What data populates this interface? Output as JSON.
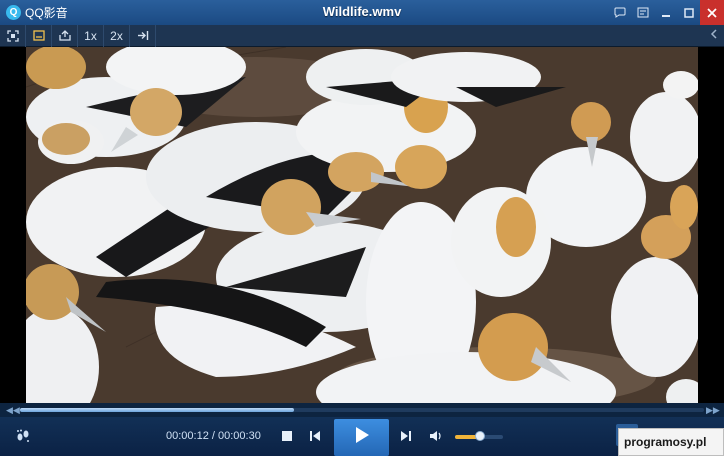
{
  "titlebar": {
    "app_name": "QQ影音",
    "file_title": "Wildlife.wmv",
    "icons": [
      "chat-icon",
      "settings-icon",
      "minimize-icon",
      "maximize-icon",
      "close-icon"
    ]
  },
  "toolbar": {
    "speed_1x": "1x",
    "speed_2x": "2x",
    "icons": [
      "fullscreen-icon",
      "subtitle-icon",
      "screenshot-icon",
      "pin-icon",
      "playlist-toggle-icon"
    ]
  },
  "progress": {
    "fraction": 0.4,
    "accent_color": "#6ea6dd"
  },
  "player": {
    "current_time": "00:00:12",
    "separator": " / ",
    "total_time": "00:00:30",
    "volume": 0.52,
    "icons": [
      "footprints-icon",
      "stop-icon",
      "previous-icon",
      "play-icon",
      "next-icon",
      "volume-icon",
      "toolbox-icon"
    ]
  },
  "watermark": {
    "text": "programosy.pl"
  }
}
